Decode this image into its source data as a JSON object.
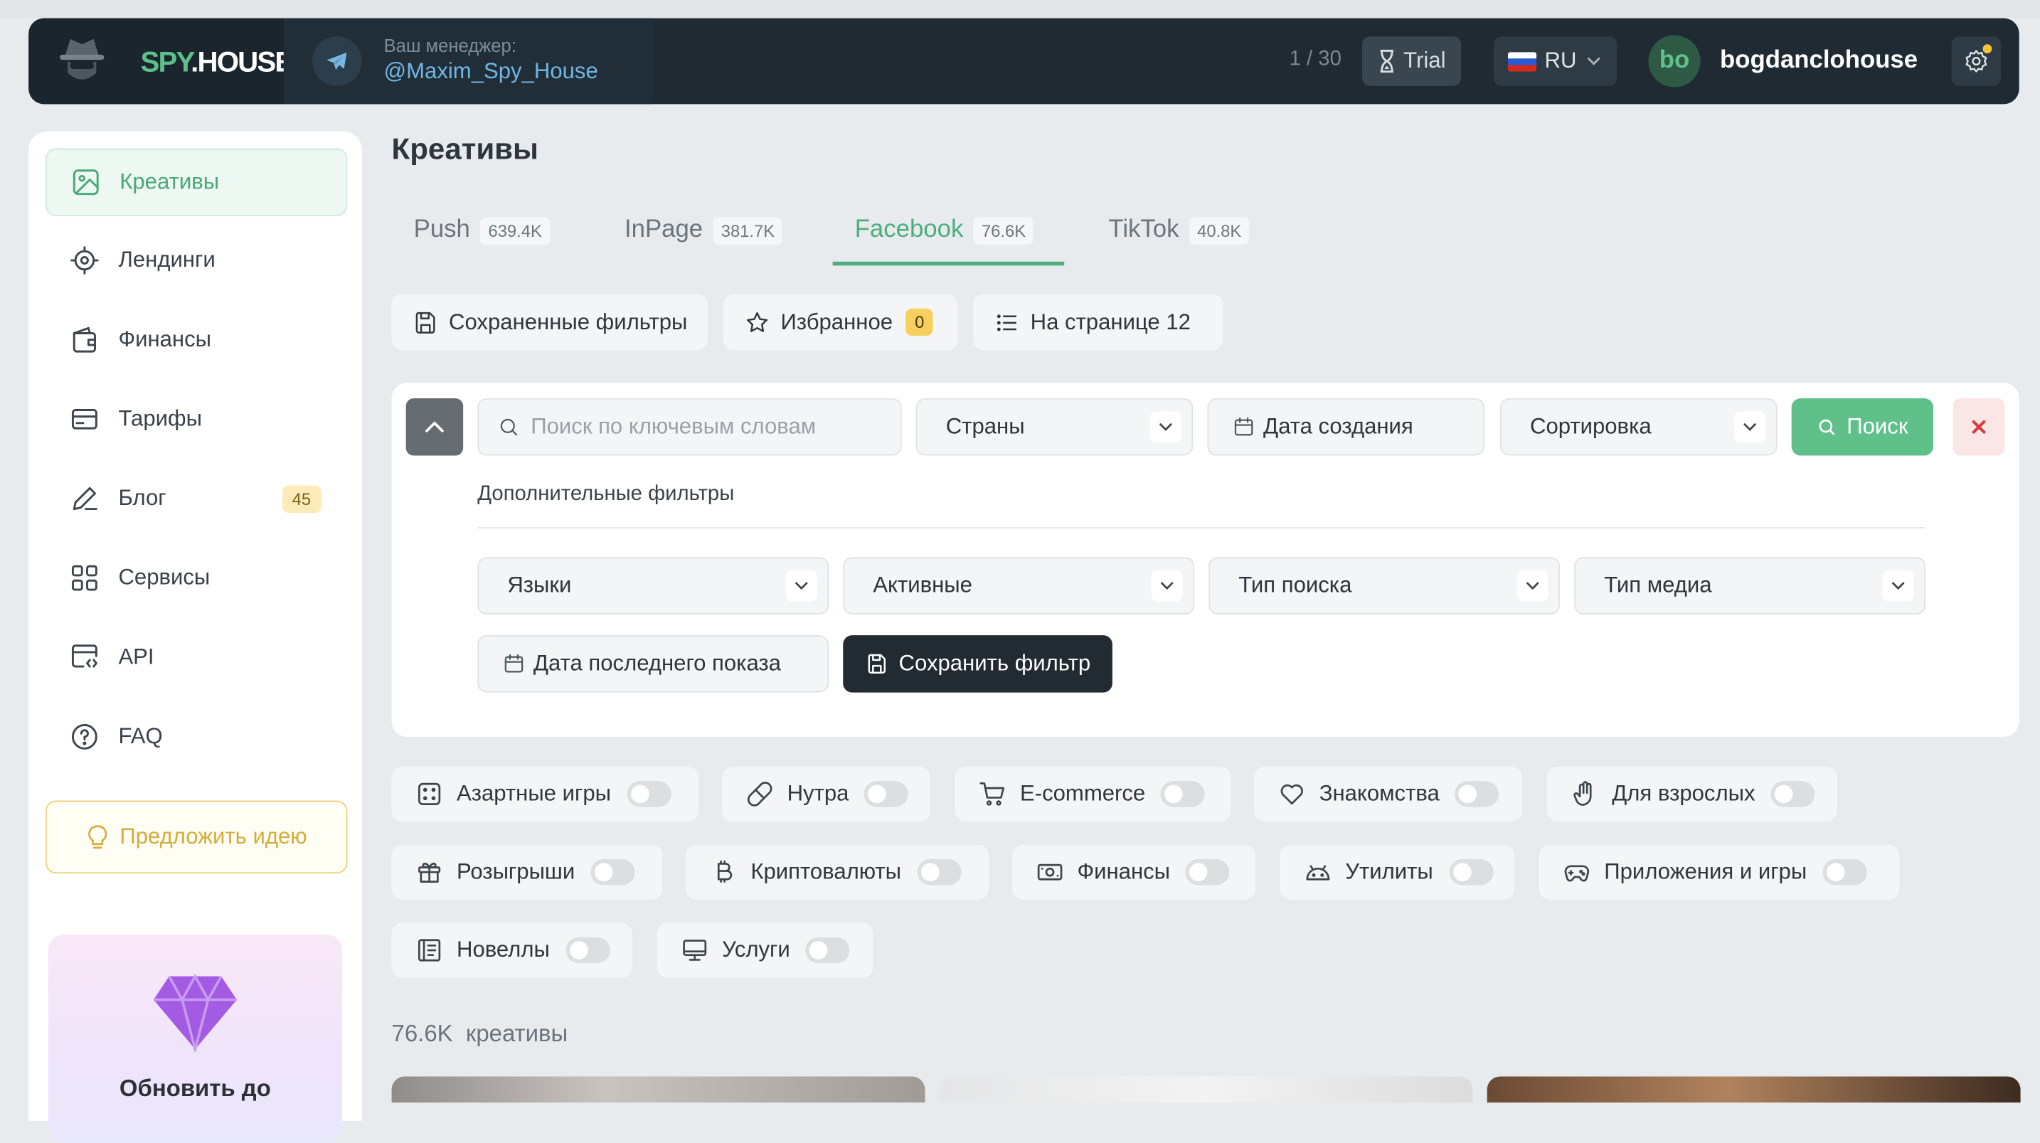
{
  "header": {
    "logo": {
      "part1": "SPY",
      "part2": ".HOUSE"
    },
    "manager_label": "Ваш менеджер:",
    "manager_name": "@Maxim_Spy_House",
    "counter": "1 / 30",
    "trial_label": "Trial",
    "language": "RU",
    "avatar_initials": "bo",
    "username": "bogdanclohouse"
  },
  "sidebar": {
    "items": [
      {
        "label": "Креативы",
        "icon": "image-icon",
        "active": true
      },
      {
        "label": "Лендинги",
        "icon": "target-icon"
      },
      {
        "label": "Финансы",
        "icon": "wallet-icon"
      },
      {
        "label": "Тарифы",
        "icon": "card-icon"
      },
      {
        "label": "Блог",
        "icon": "pen-icon",
        "badge": "45"
      },
      {
        "label": "Сервисы",
        "icon": "grid-icon"
      },
      {
        "label": "API",
        "icon": "code-window-icon"
      },
      {
        "label": "FAQ",
        "icon": "question-icon"
      }
    ],
    "suggest_idea": "Предложить идею",
    "upgrade_text": "Обновить до"
  },
  "main": {
    "title": "Креативы",
    "tabs": [
      {
        "label": "Push",
        "count": "639.4K"
      },
      {
        "label": "InPage",
        "count": "381.7K"
      },
      {
        "label": "Facebook",
        "count": "76.6K",
        "active": true
      },
      {
        "label": "TikTok",
        "count": "40.8K"
      }
    ],
    "toolbar": {
      "saved_filters": "Сохраненные фильтры",
      "favorites": "Избранное",
      "favorites_count": "0",
      "per_page": "На странице 12"
    },
    "filters": {
      "search_placeholder": "Поиск по ключевым словам",
      "countries": "Страны",
      "created_date": "Дата создания",
      "sorting": "Сортировка",
      "search_button": "Поиск",
      "extra_title": "Дополнительные фильтры",
      "languages": "Языки",
      "active": "Активные",
      "search_type": "Тип поиска",
      "media_type": "Тип медиа",
      "last_shown_date": "Дата последнего показа",
      "save_filter": "Сохранить фильтр"
    },
    "categories": [
      {
        "label": "Азартные игры",
        "icon": "dice-icon",
        "enabled": false
      },
      {
        "label": "Нутра",
        "icon": "pill-icon",
        "enabled": false
      },
      {
        "label": "E-commerce",
        "icon": "cart-icon",
        "enabled": false
      },
      {
        "label": "Знакомства",
        "icon": "heart-icon",
        "enabled": false
      },
      {
        "label": "Для взрослых",
        "icon": "hand-icon",
        "enabled": false
      },
      {
        "label": "Розыгрыши",
        "icon": "gift-icon",
        "enabled": false
      },
      {
        "label": "Криптовалюты",
        "icon": "bitcoin-icon",
        "enabled": false
      },
      {
        "label": "Финансы",
        "icon": "money-icon",
        "enabled": false
      },
      {
        "label": "Утилиты",
        "icon": "android-icon",
        "enabled": false
      },
      {
        "label": "Приложения и игры",
        "icon": "gamepad-icon",
        "enabled": false
      },
      {
        "label": "Новеллы",
        "icon": "book-icon",
        "enabled": false
      },
      {
        "label": "Услуги",
        "icon": "monitor-icon",
        "enabled": false
      }
    ],
    "total_count": "76.6K",
    "total_label": "креативы"
  },
  "colors": {
    "accent": "#5fc08a",
    "header_bg": "#1f2a33",
    "page_bg": "#e8ebee",
    "badge_yellow": "#f7cf5c",
    "danger": "#d23c3c"
  }
}
